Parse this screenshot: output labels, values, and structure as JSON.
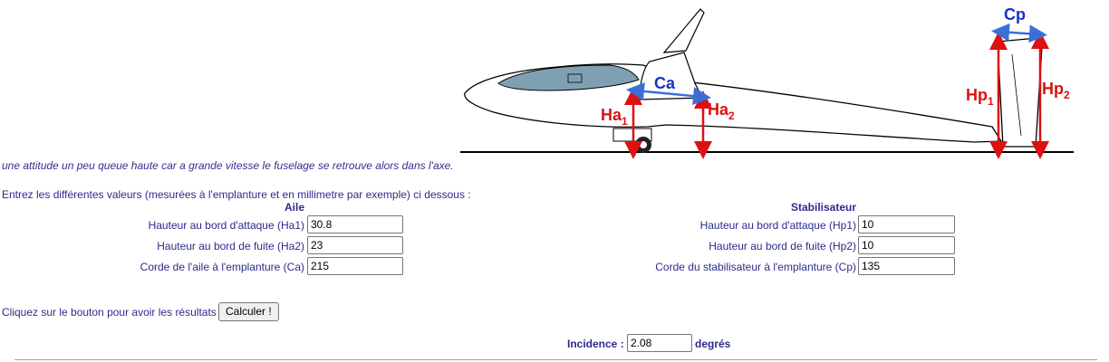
{
  "diagram": {
    "labels": {
      "ca": "Ca",
      "cp": "Cp",
      "ha": "Ha",
      "ha_sub1": "1",
      "ha_sub2": "2",
      "hp": "Hp",
      "hp_sub1": "1",
      "hp_sub2": "2"
    },
    "colors": {
      "red_arrow": "#dd1111",
      "blue_arrow": "#3a6fd8",
      "blue_text": "#1530c8",
      "canopy": "#7fa0b3"
    }
  },
  "intro_text": "une attitude un peu queue haute car a grande vitesse le fuselage se retrouve alors dans l'axe.",
  "instructions": "Entrez les différentes valeurs (mesurées à l'emplanture et en millimetre par exemple) ci dessous :",
  "wing": {
    "title": "Aile",
    "fields": [
      {
        "label": "Hauteur au bord d'attaque (Ha1)",
        "value": "30.8"
      },
      {
        "label": "Hauteur au bord de fuite (Ha2)",
        "value": "23"
      },
      {
        "label": "Corde de l'aile à l'emplanture (Ca)",
        "value": "215"
      }
    ]
  },
  "stab": {
    "title": "Stabilisateur",
    "fields": [
      {
        "label": "Hauteur au bord d'attaque (Hp1)",
        "value": "10"
      },
      {
        "label": "Hauteur au bord de fuite (Hp2)",
        "value": "10"
      },
      {
        "label": "Corde du stabilisateur à l'emplanture (Cp)",
        "value": "135"
      }
    ]
  },
  "action": {
    "prompt": "Cliquez sur le bouton pour avoir les résultats",
    "button_label": "Calculer !"
  },
  "result": {
    "label": "Incidence :",
    "value": "2.08",
    "unit": "degrés"
  }
}
